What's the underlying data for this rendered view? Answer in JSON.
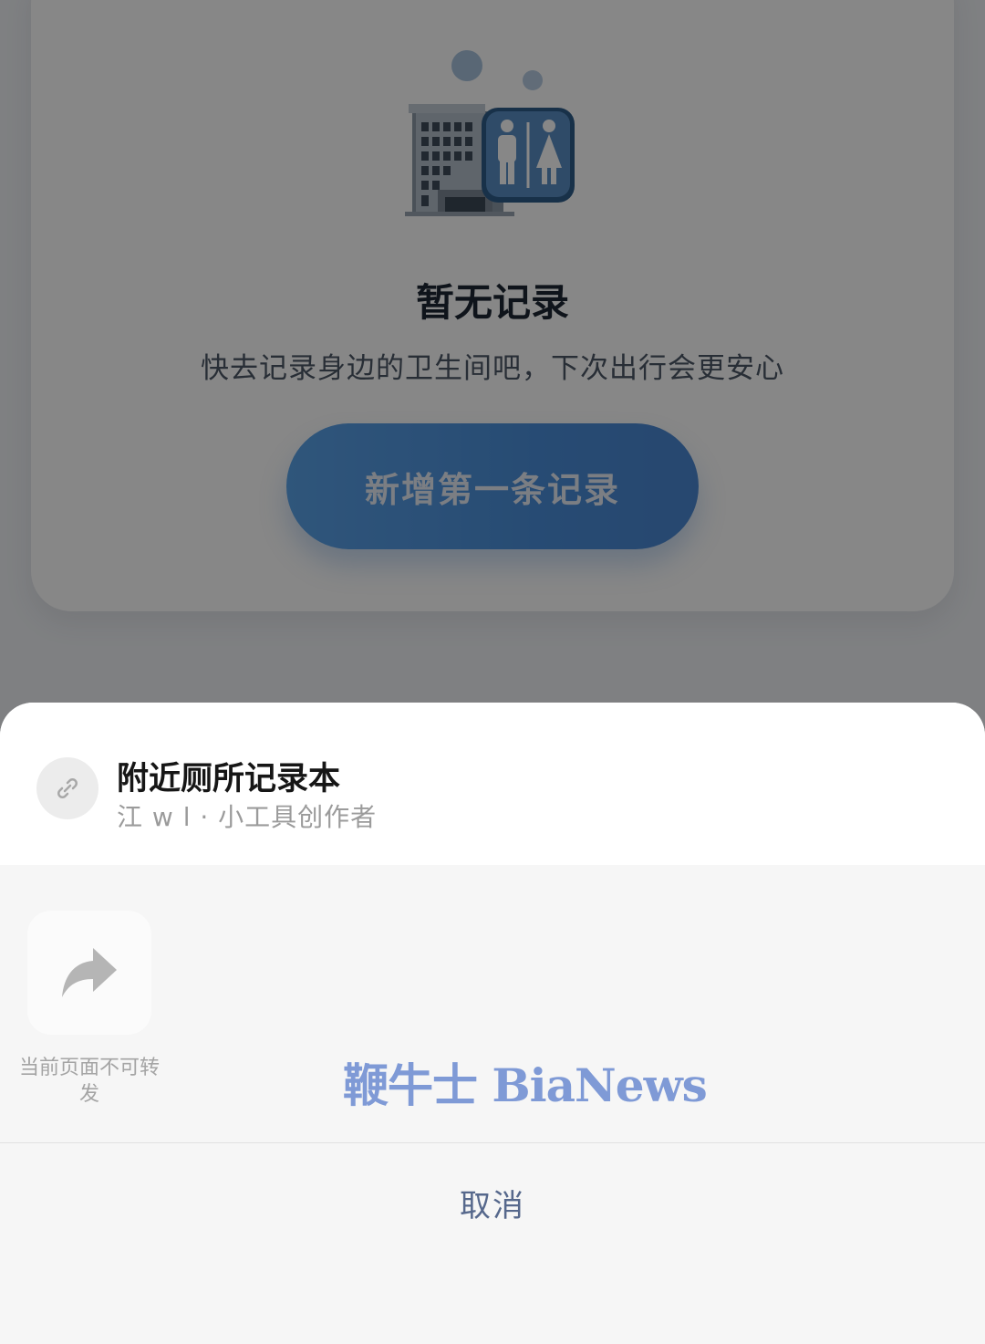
{
  "empty_state": {
    "title": "暂无记录",
    "subtitle": "快去记录身边的卫生间吧，下次出行会更安心",
    "add_button": "新增第一条记录",
    "illustration_icons": [
      "office-building-icon",
      "restroom-icon"
    ]
  },
  "share_sheet": {
    "app_name": "附近厕所记录本",
    "app_author": "江 w l · 小工具创作者",
    "app_icon": "link-icon",
    "actions": [
      {
        "icon": "forward-arrow-icon",
        "label": "当前页面不可转发",
        "enabled": false
      }
    ],
    "cancel_label": "取消"
  },
  "watermark": "鞭牛士 BiaNews",
  "colors": {
    "button_blue": "#4b8fdb",
    "cancel_text": "#56688c",
    "watermark": "#7f9ad6"
  }
}
